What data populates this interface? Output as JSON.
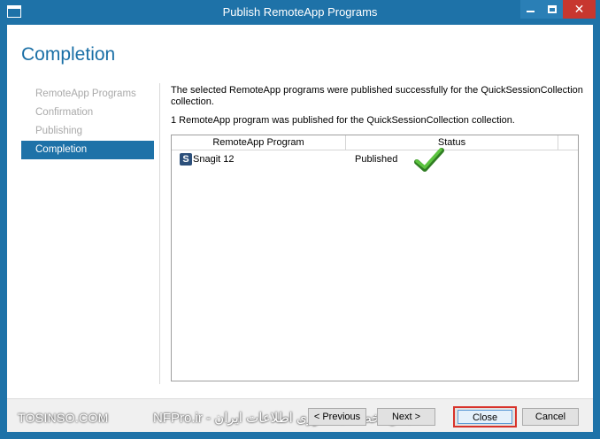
{
  "window": {
    "title": "Publish RemoteApp Programs"
  },
  "page": {
    "heading": "Completion"
  },
  "nav": {
    "items": [
      {
        "label": "RemoteApp Programs",
        "active": false
      },
      {
        "label": "Confirmation",
        "active": false
      },
      {
        "label": "Publishing",
        "active": false
      },
      {
        "label": "Completion",
        "active": true
      }
    ]
  },
  "content": {
    "message_success": "The selected RemoteApp programs were published successfully for the QuickSessionCollection collection.",
    "message_count": "1 RemoteApp program was published for the QuickSessionCollection collection."
  },
  "grid": {
    "columns": [
      "RemoteApp Program",
      "Status"
    ],
    "rows": [
      {
        "icon": "snagit-app-icon",
        "icon_letter": "S",
        "program": "Snagit 12",
        "status": "Published",
        "status_icon": "green-checkmark-icon"
      }
    ]
  },
  "footer": {
    "watermark_left": "TOSINSO.COM",
    "watermark_right": "انجمن تخصصی فناوری اطلاعات ایران - NFPro.ir",
    "buttons": {
      "previous": "< Previous",
      "next": "Next >",
      "close": "Close",
      "cancel": "Cancel"
    }
  },
  "colors": {
    "accent": "#1e72a8",
    "heading": "#1a6fa6",
    "close_highlight": "#d8322a",
    "check": "#3fa82c"
  }
}
